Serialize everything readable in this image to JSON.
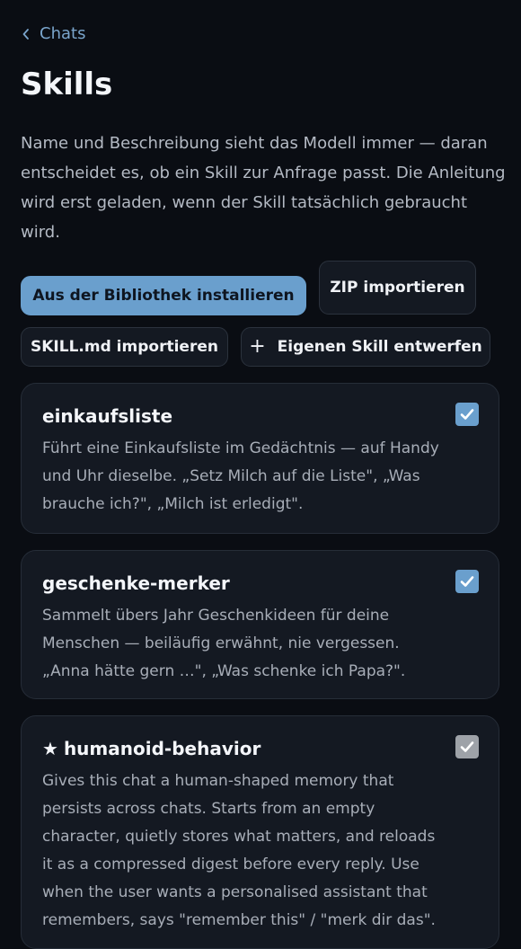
{
  "nav": {
    "back_label": "Chats"
  },
  "page": {
    "title": "Skills",
    "description": "Name und Beschreibung sieht das Modell immer — daran entscheidet es, ob ein Skill zur Anfrage passt. Die Anleitung wird erst geladen, wenn der Skill tatsächlich gebraucht wird."
  },
  "actions": {
    "install_library": "Aus der Bibliothek installieren",
    "import_zip": "ZIP importieren",
    "import_skillmd": "SKILL.md importieren",
    "create_own_symbol": "+",
    "create_own": "Eigenen Skill entwerfen"
  },
  "skills": [
    {
      "name": "einkaufsliste",
      "description": "Führt eine Einkaufsliste im Gedächtnis — auf Handy und Uhr dieselbe. „Setz Milch auf die Liste\", „Was brauche ich?\", „Milch ist erledigt\".",
      "enabled": true
    },
    {
      "name": "geschenke-merker",
      "description": "Sammelt übers Jahr Geschenkideen für deine Menschen — beiläufig erwähnt, nie vergessen. „Anna hätte gern …\", „Was schenke ich Papa?\".",
      "enabled": true
    },
    {
      "star": "★",
      "name": "humanoid-behavior",
      "description": "Gives this chat a human-shaped memory that persists across chats. Starts from an empty character, quietly stores what matters, and reloads it as a compressed digest before every reply. Use when the user wants a personalised assistant that remembers, says \"remember this\" / \"merk dir das\".",
      "enabled": true,
      "locked": true
    }
  ],
  "colors": {
    "background": "#0a0d13",
    "card": "#141922",
    "accent": "#6a9fcd",
    "link": "#7aa5cc",
    "muted_text": "#a8aeb8",
    "disabled_check": "#9ea2a8"
  },
  "icons": {
    "back": "chevron-left-icon",
    "check": "checkmark-icon",
    "star": "star-icon",
    "plus": "plus-icon"
  }
}
